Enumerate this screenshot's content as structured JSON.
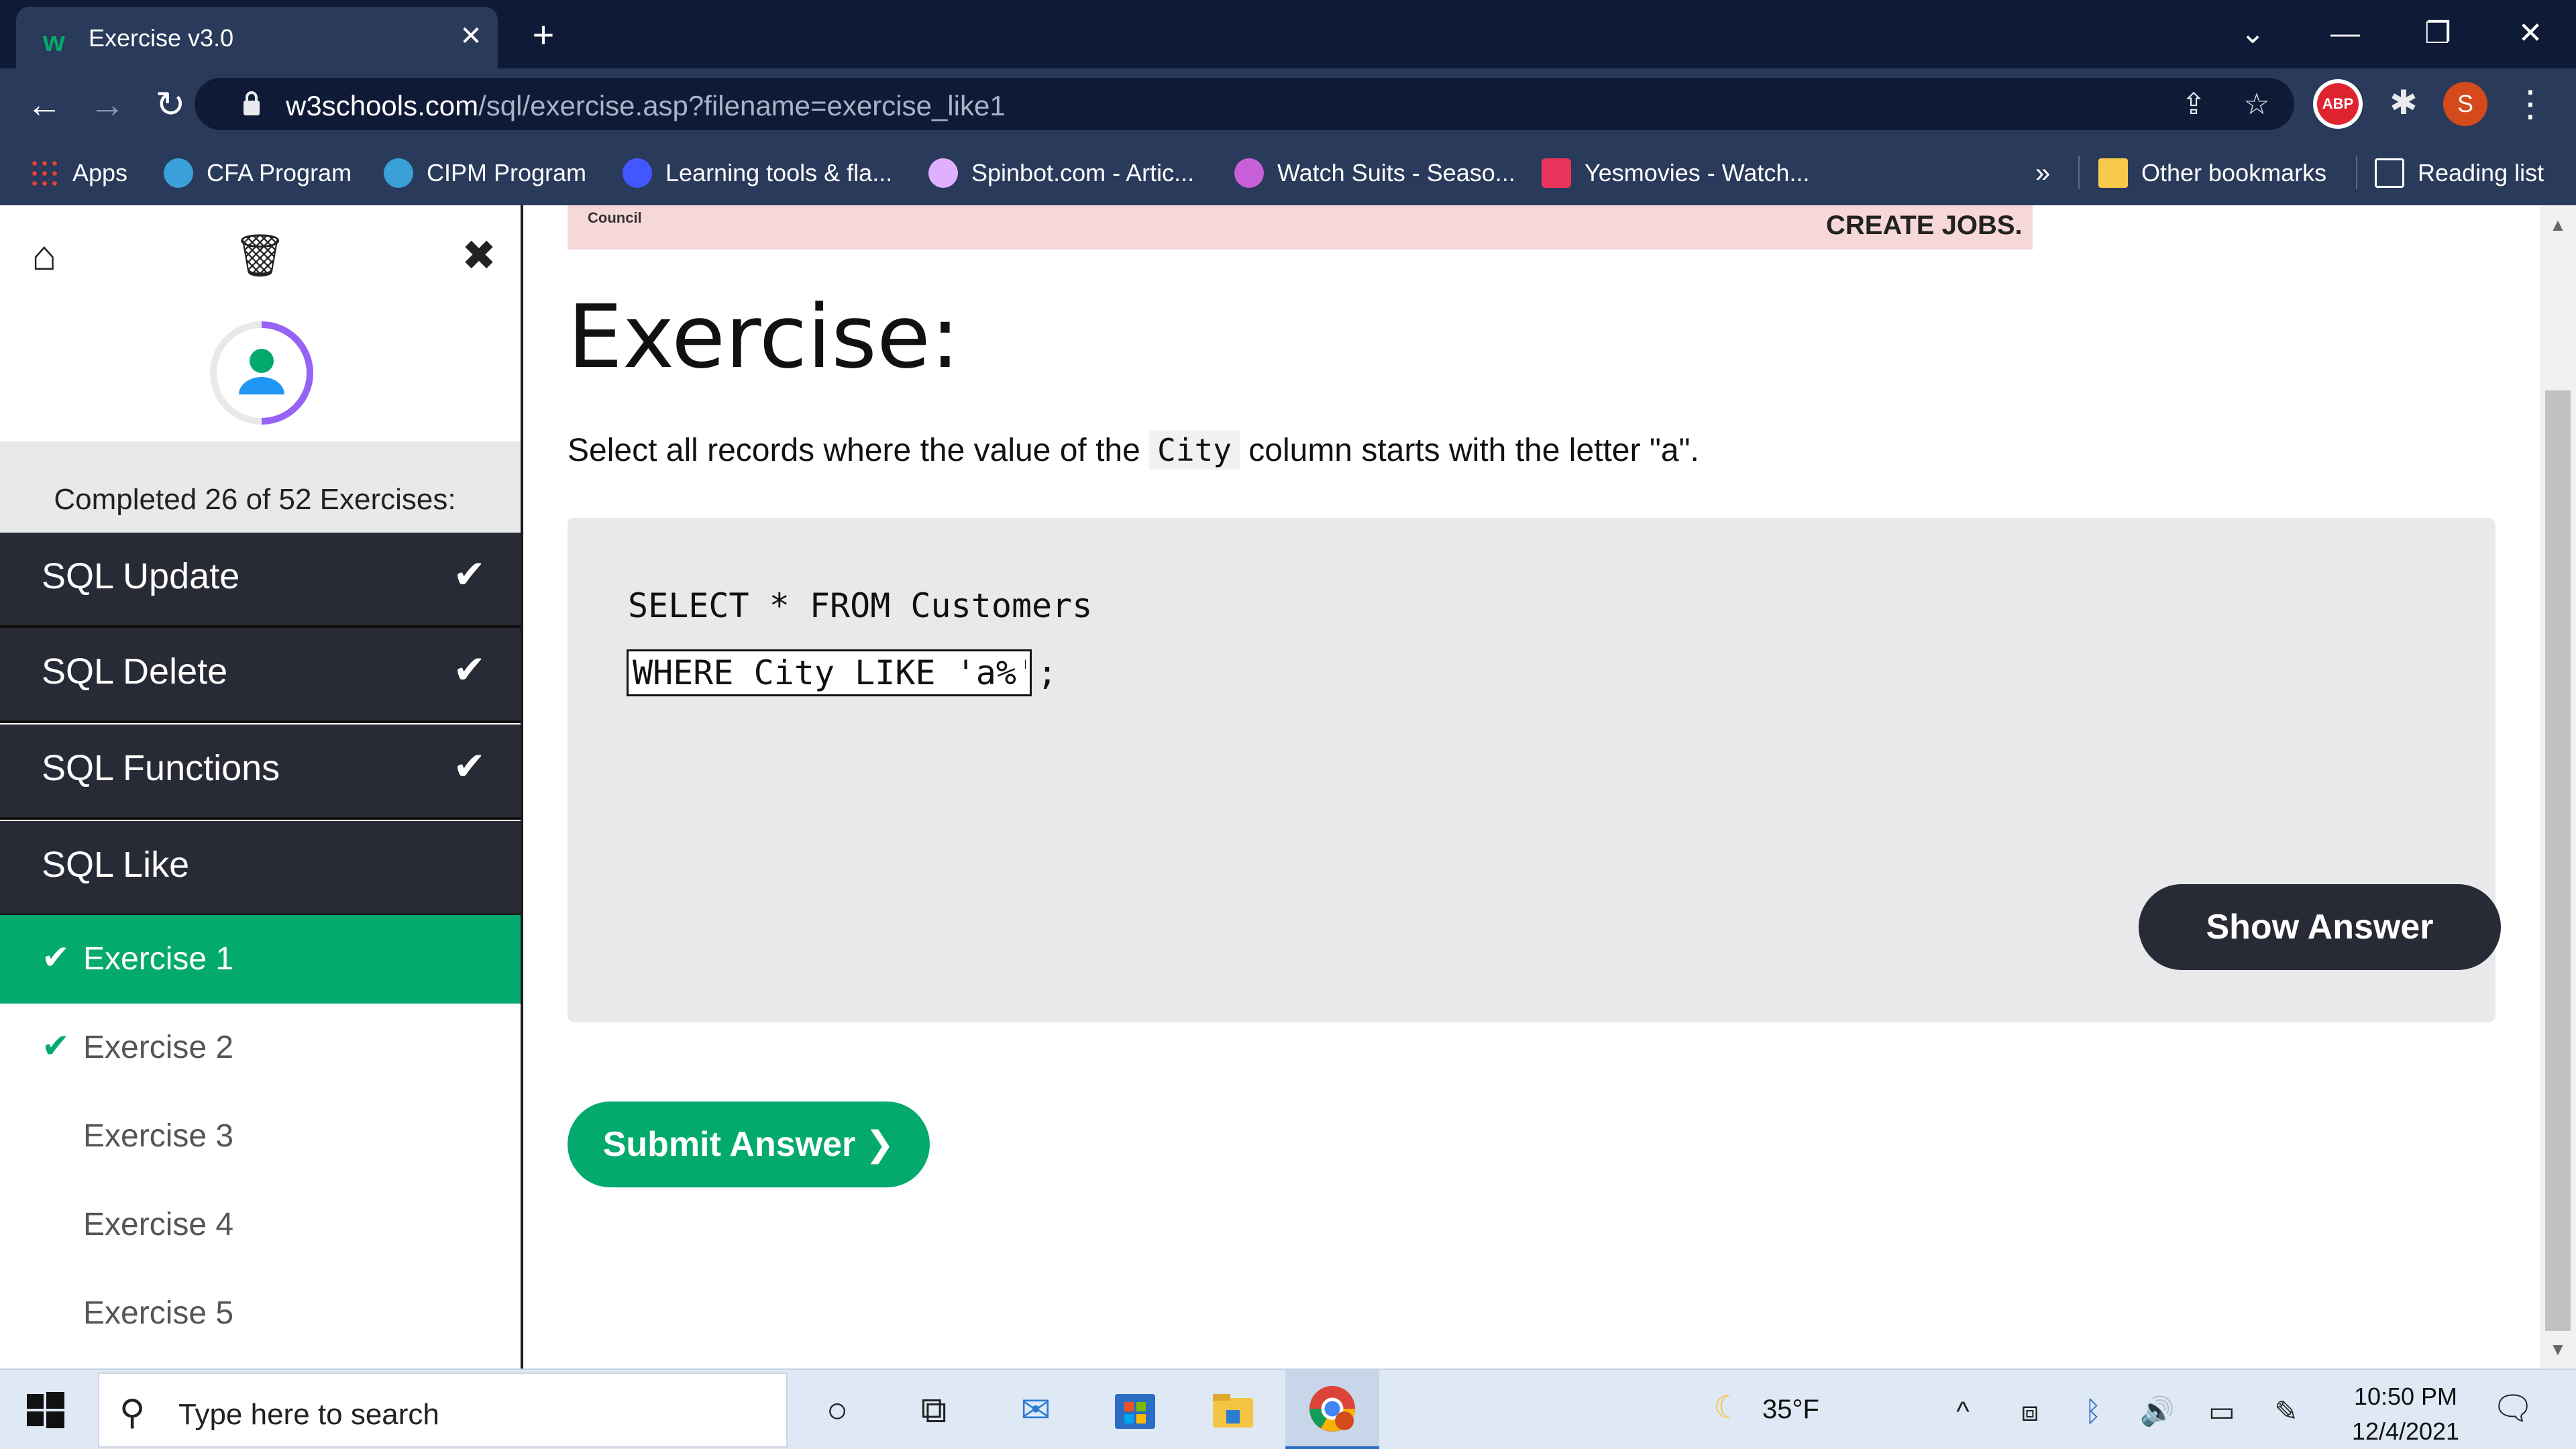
{
  "browser": {
    "tab_title": "Exercise v3.0",
    "new_tab_icon": "+",
    "url_host": "w3schools.com",
    "url_path": "/sql/exercise.asp?filename=exercise_like1",
    "abp_label": "ABP",
    "profile_initial": "S"
  },
  "bookmarks": {
    "apps": "Apps",
    "items": [
      "CFA Program",
      "CIPM Program",
      "Learning tools & fla...",
      "Spinbot.com - Artic...",
      "Watch Suits - Seaso...",
      "Yesmovies - Watch..."
    ],
    "overflow": "»",
    "other": "Other bookmarks",
    "reading_list": "Reading list"
  },
  "sidebar": {
    "progress_text": "Completed 26 of 52 Exercises:",
    "categories": [
      {
        "label": "SQL Update",
        "done": true
      },
      {
        "label": "SQL Delete",
        "done": true
      },
      {
        "label": "SQL Functions",
        "done": true
      },
      {
        "label": "SQL Like",
        "done": false
      }
    ],
    "exercises": [
      "Exercise 1",
      "Exercise 2",
      "Exercise 3",
      "Exercise 4",
      "Exercise 5"
    ],
    "check_glyph": "✔"
  },
  "ad": {
    "text": "CREATE JOBS.",
    "logo": "Council"
  },
  "exercise": {
    "title": "Exercise:",
    "desc_before": "Select all records where the value of the ",
    "desc_code": "City",
    "desc_after": " column starts with the letter \"a\".",
    "code_line1": "SELECT * FROM Customers",
    "answer_value": "WHERE City LIKE 'a%'",
    "semicolon": ";",
    "show_answer": "Show Answer",
    "submit": "Submit Answer ❯"
  },
  "taskbar": {
    "search_placeholder": "Type here to search",
    "weather": "35°F",
    "time": "10:50 PM",
    "date": "12/4/2021"
  },
  "colors": {
    "accent_green": "#04aa6d",
    "dark_nav": "#282a35",
    "chrome_dark": "#0f1b36",
    "chrome_mid": "#2a3a5a"
  }
}
